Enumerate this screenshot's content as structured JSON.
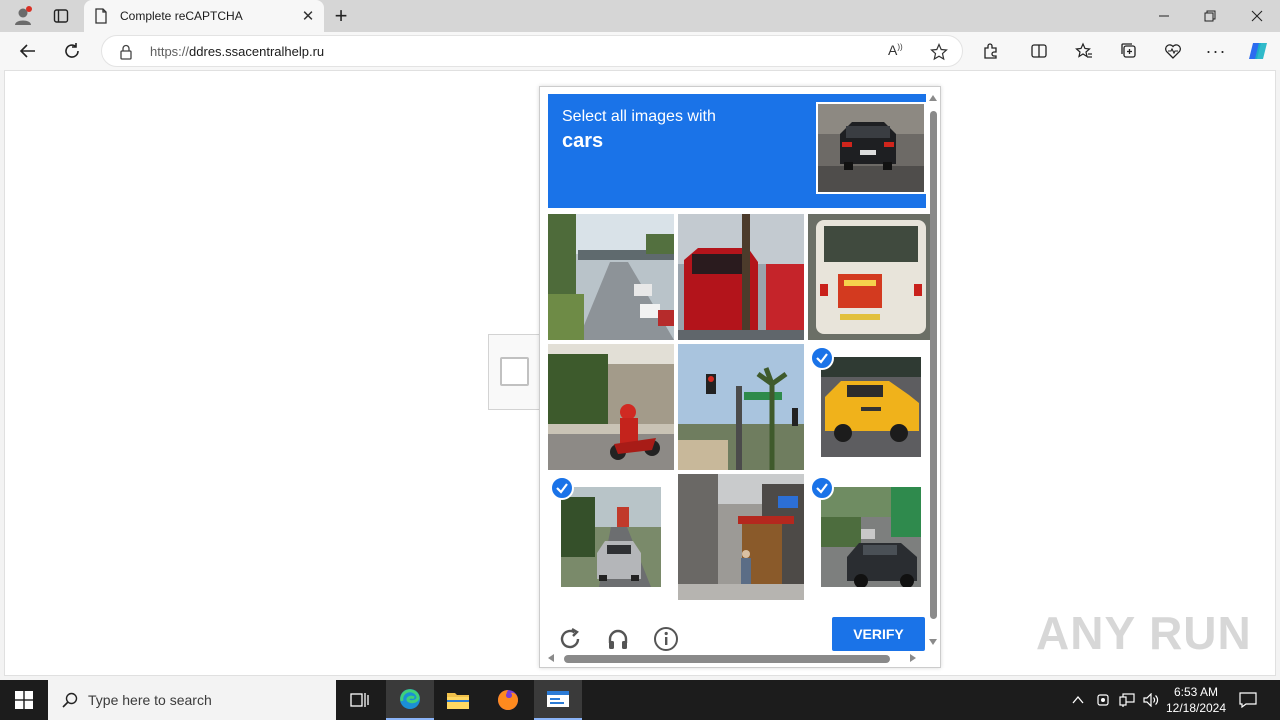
{
  "browser": {
    "tab_title": "Complete reCAPTCHA",
    "url_scheme": "https://",
    "url_host": "ddres.ssacentralhelp.ru",
    "window_controls": [
      "minimize",
      "restore",
      "close"
    ]
  },
  "captcha": {
    "instruction_line1": "Select all images with",
    "instruction_target": "cars",
    "verify_label": "VERIFY",
    "accent_color": "#1a73e8",
    "tiles": [
      {
        "row": 1,
        "col": 1,
        "depicts": "highway-overpass",
        "selected": false
      },
      {
        "row": 1,
        "col": 2,
        "depicts": "red-truck",
        "selected": false
      },
      {
        "row": 1,
        "col": 3,
        "depicts": "bus-rear",
        "selected": false
      },
      {
        "row": 2,
        "col": 1,
        "depicts": "motorcycle-street",
        "selected": false
      },
      {
        "row": 2,
        "col": 2,
        "depicts": "traffic-light-palm",
        "selected": false
      },
      {
        "row": 2,
        "col": 3,
        "depicts": "yellow-taxi",
        "selected": true
      },
      {
        "row": 3,
        "col": 1,
        "depicts": "car-street",
        "selected": true
      },
      {
        "row": 3,
        "col": 2,
        "depicts": "alley-pedestrian",
        "selected": false
      },
      {
        "row": 3,
        "col": 3,
        "depicts": "parked-car",
        "selected": true
      }
    ]
  },
  "watermark": "ANY RUN",
  "taskbar": {
    "search_placeholder": "Type here to search",
    "time": "6:53 AM",
    "date": "12/18/2024"
  }
}
